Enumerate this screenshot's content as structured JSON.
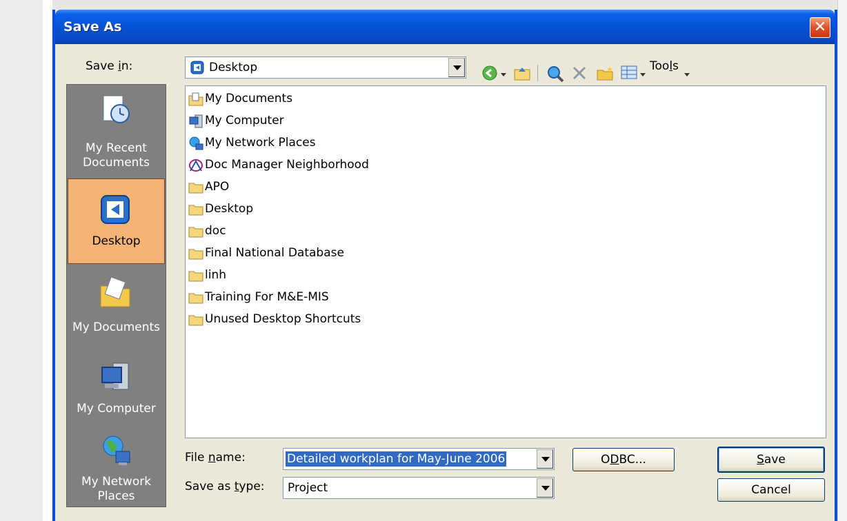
{
  "dialog": {
    "title": "Save As",
    "close_label": "✕"
  },
  "toolbar": {
    "save_in_label_pre": "Save ",
    "save_in_label_u": "i",
    "save_in_label_post": "n:",
    "save_in_value": "Desktop",
    "tools_label_pre": "Too",
    "tools_label_u": "l",
    "tools_label_post": "s",
    "icons": [
      "back-icon",
      "up-folder-icon",
      "search-web-icon",
      "delete-icon",
      "new-folder-icon",
      "views-icon"
    ]
  },
  "places": [
    {
      "label": "My Recent\nDocuments",
      "icon": "recent-documents-icon"
    },
    {
      "label": "Desktop",
      "icon": "desktop-icon",
      "selected": true
    },
    {
      "label": "My Documents",
      "icon": "my-documents-icon"
    },
    {
      "label": "My Computer",
      "icon": "my-computer-icon"
    },
    {
      "label": "My Network\nPlaces",
      "icon": "network-places-icon"
    }
  ],
  "files": [
    {
      "name": "My Documents",
      "icon": "my-documents-icon"
    },
    {
      "name": "My Computer",
      "icon": "my-computer-icon"
    },
    {
      "name": "My Network Places",
      "icon": "network-places-icon"
    },
    {
      "name": "Doc Manager Neighborhood",
      "icon": "doc-manager-icon"
    },
    {
      "name": "APO",
      "icon": "folder-icon"
    },
    {
      "name": "Desktop",
      "icon": "folder-icon"
    },
    {
      "name": "doc",
      "icon": "folder-icon"
    },
    {
      "name": "Final National Database",
      "icon": "folder-icon"
    },
    {
      "name": "linh",
      "icon": "folder-icon"
    },
    {
      "name": "Training For M&E-MIS",
      "icon": "folder-icon"
    },
    {
      "name": "Unused Desktop Shortcuts",
      "icon": "folder-icon"
    }
  ],
  "form": {
    "filename_label_pre": "File ",
    "filename_label_u": "n",
    "filename_label_post": "ame:",
    "filename_value": "Detailed workplan for May-June 2006",
    "type_label_pre": "Save as ",
    "type_label_u": "t",
    "type_label_post": "ype:",
    "type_value": "Project"
  },
  "buttons": {
    "odbc_pre": "O",
    "odbc_u": "D",
    "odbc_post": "BC...",
    "save_u": "S",
    "save_post": "ave",
    "cancel": "Cancel"
  },
  "colors": {
    "titlebar": "#0553d6",
    "dialog_bg": "#ece9d8",
    "places_bg": "#808080",
    "selected_place": "#f5b374",
    "selection_highlight": "#316ac5"
  }
}
